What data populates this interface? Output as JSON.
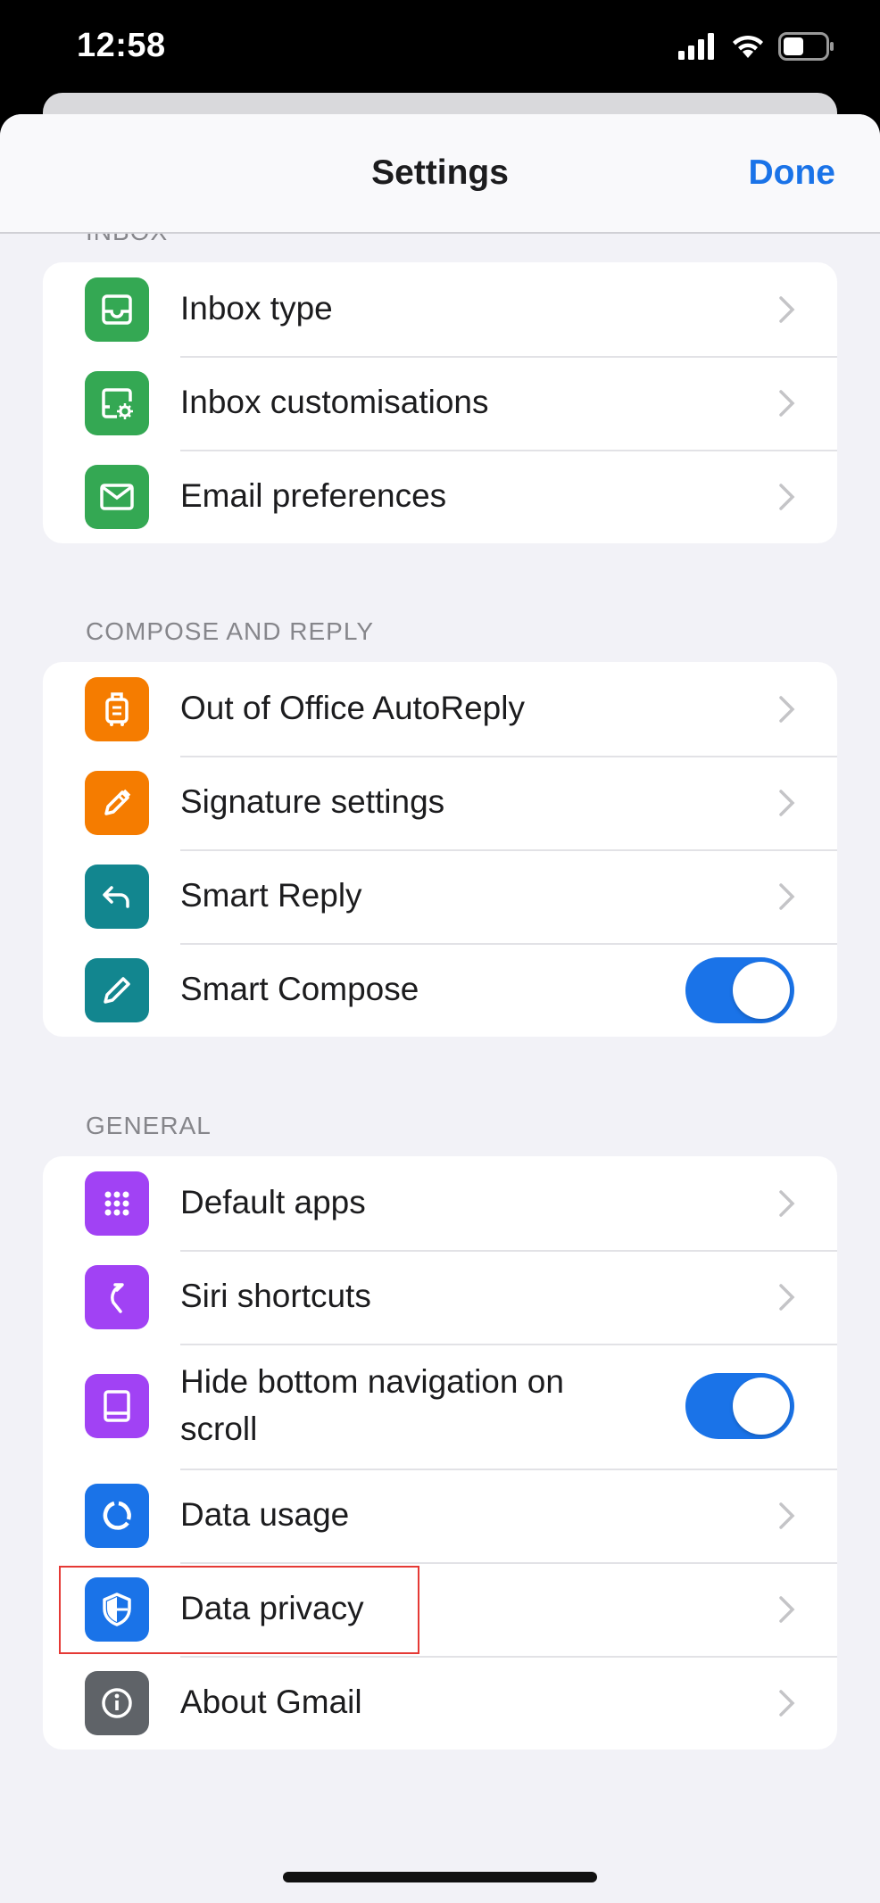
{
  "status_bar": {
    "time": "12:58"
  },
  "nav": {
    "title": "Settings",
    "done_label": "Done"
  },
  "sections": {
    "inbox": {
      "header": "INBOX",
      "items": [
        {
          "label": "Inbox type",
          "icon": "inbox-icon",
          "color": "#34a853"
        },
        {
          "label": "Inbox customisations",
          "icon": "inbox-settings-icon",
          "color": "#34a853"
        },
        {
          "label": "Email preferences",
          "icon": "envelope-icon",
          "color": "#34a853"
        }
      ]
    },
    "compose": {
      "header": "COMPOSE AND REPLY",
      "items": [
        {
          "label": "Out of Office AutoReply",
          "icon": "suitcase-icon",
          "color": "#f57c00"
        },
        {
          "label": "Signature settings",
          "icon": "pen-icon",
          "color": "#f57c00"
        },
        {
          "label": "Smart Reply",
          "icon": "reply-icon",
          "color": "#12868f"
        },
        {
          "label": "Smart Compose",
          "icon": "pencil-icon",
          "color": "#12868f",
          "toggle": true
        }
      ]
    },
    "general": {
      "header": "GENERAL",
      "items": [
        {
          "label": "Default apps",
          "icon": "grid-icon",
          "color": "#a142f4"
        },
        {
          "label": "Siri shortcuts",
          "icon": "siri-shortcut-icon",
          "color": "#a142f4"
        },
        {
          "label": "Hide bottom navigation on scroll",
          "icon": "tablet-icon",
          "color": "#a142f4",
          "toggle": true
        },
        {
          "label": "Data usage",
          "icon": "data-usage-icon",
          "color": "#1a73e8"
        },
        {
          "label": "Data privacy",
          "icon": "shield-icon",
          "color": "#1a73e8"
        },
        {
          "label": "About Gmail",
          "icon": "info-icon",
          "color": "#5f6368"
        }
      ]
    }
  },
  "colors": {
    "accent": "#1a73e8",
    "highlight": "#e53935"
  }
}
